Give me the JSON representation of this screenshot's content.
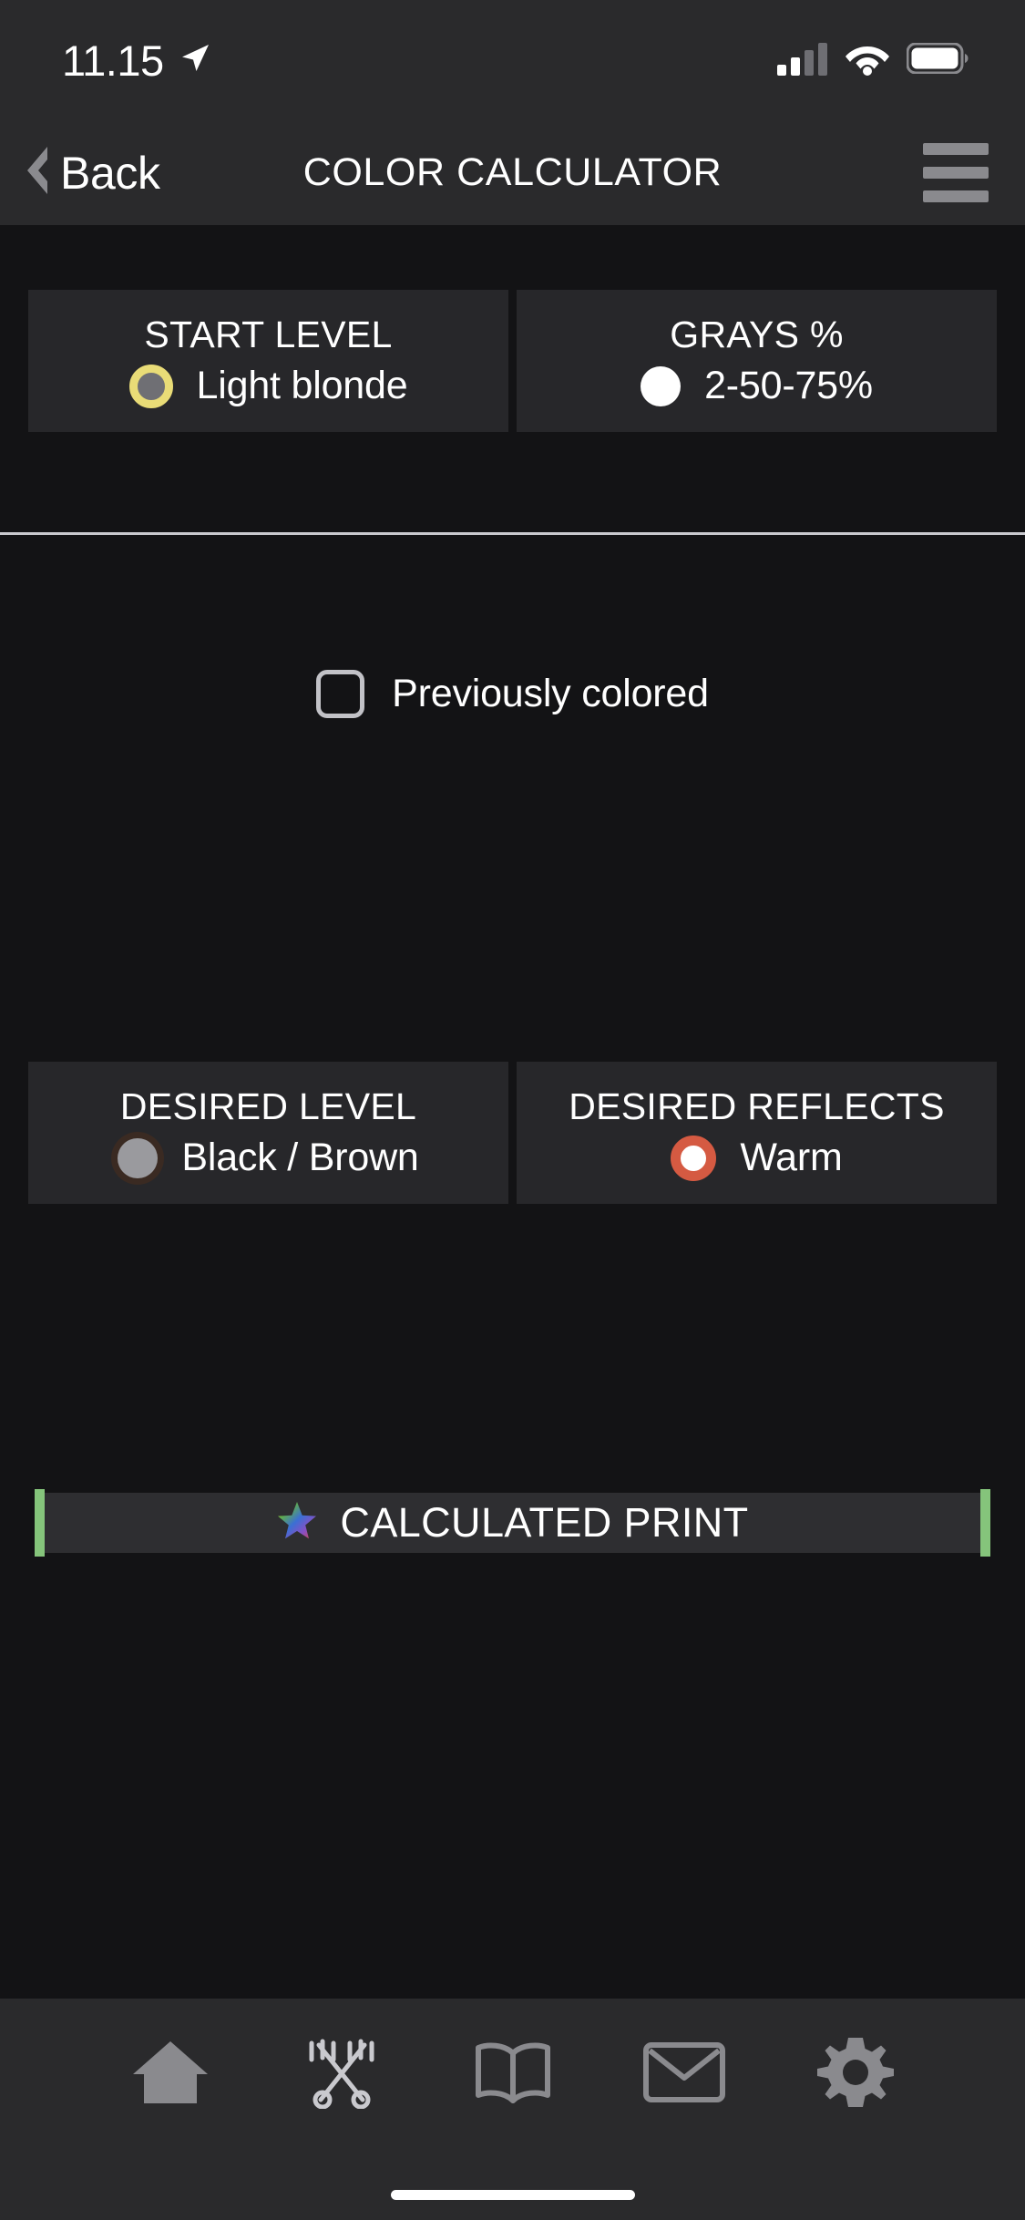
{
  "statusbar": {
    "time": "11.15",
    "location_icon": "location-arrow-icon",
    "signal_icon": "cellular-signal-icon",
    "wifi_icon": "wifi-icon",
    "battery_icon": "battery-icon"
  },
  "navbar": {
    "back_label": "Back",
    "back_icon": "chevron-left-icon",
    "title": "COLOR CALCULATOR",
    "menu_icon": "hamburger-menu-icon"
  },
  "start_section": {
    "cards": [
      {
        "title": "START LEVEL",
        "value": "Light blonde",
        "swatch_icon": "color-swatch-icon",
        "swatch_ring_color": "#E9DC77",
        "swatch_fill_color": "#6F6F74"
      },
      {
        "title": "GRAYS %",
        "value": "2-50-75%",
        "swatch_icon": "color-swatch-icon",
        "swatch_ring_color": "#FFFFFF",
        "swatch_fill_color": "#FFFFFF"
      }
    ],
    "checkbox": {
      "label": "Previously colored",
      "checked": false,
      "icon": "checkbox-unchecked-icon"
    }
  },
  "desired_section": {
    "cards": [
      {
        "title": "DESIRED LEVEL",
        "value": "Black / Brown",
        "swatch_icon": "color-swatch-icon",
        "swatch_ring_color": "#3A2A22",
        "swatch_fill_color": "#9A9A9E"
      },
      {
        "title": "DESIRED REFLECTS",
        "value": "Warm",
        "swatch_icon": "color-swatch-icon",
        "swatch_ring_color": "#D55A42",
        "swatch_fill_color": "#FFFFFF"
      }
    ]
  },
  "calculated_print": {
    "label": "CALCULATED PRINT",
    "icon": "rainbow-star-icon",
    "edge_color": "#85C47B"
  },
  "tabbar": {
    "items": [
      {
        "name": "home",
        "icon": "home-icon"
      },
      {
        "name": "tools",
        "icon": "scissors-comb-icon"
      },
      {
        "name": "book",
        "icon": "open-book-icon"
      },
      {
        "name": "mail",
        "icon": "mail-envelope-icon"
      },
      {
        "name": "settings",
        "icon": "gear-icon"
      }
    ],
    "home_indicator": "home-indicator"
  },
  "theme": {
    "background": "#131315",
    "card_background": "#27272A",
    "bar_background": "#2A2A2C",
    "text_primary": "#FFFFFF",
    "accent_green": "#85C47B",
    "accent_orange": "#D55A42",
    "accent_yellow": "#E9DC77"
  }
}
